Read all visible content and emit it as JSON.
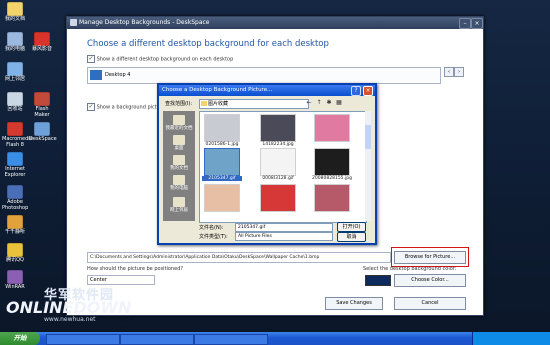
{
  "desktop": {
    "icons": [
      {
        "label": "我的文档",
        "color": "#f2d46b"
      },
      {
        "label": "我的电脑",
        "color": "#9bb8e0"
      },
      {
        "label": "网上邻居",
        "color": "#7fb3e8"
      },
      {
        "label": "回收站",
        "color": "#c9d6e3"
      },
      {
        "label": "Macromedia Flash 8",
        "color": "#d63a2e"
      },
      {
        "label": "Internet Explorer",
        "color": "#3a8ee6"
      },
      {
        "label": "Adobe Photoshop",
        "color": "#4a6fb8"
      },
      {
        "label": "千千静听",
        "color": "#e2a13a"
      },
      {
        "label": "腾讯QQ",
        "color": "#e8c23a"
      },
      {
        "label": "WinRAR",
        "color": "#8a5fb4"
      },
      {
        "label": "暴风影音",
        "color": "#d9342b"
      },
      {
        "label": "Flash Maker",
        "color": "#c24a3a"
      },
      {
        "label": "DeskSpace",
        "color": "#6d9fd8"
      }
    ]
  },
  "app": {
    "title": "Manage Desktop Backgrounds - DeskSpace",
    "heading": "Choose a different desktop background for each desktop",
    "show_different_label": "Show a different desktop background on each desktop",
    "desktop_item": "Desktop 4",
    "show_picture_label": "Show a background picture on the",
    "path_value": "C:\\Documents and Settings\\Administrator\\Application Data\\Otaku\\DeskSpace\\Wallpaper Cache\\1.bmp",
    "browse_label": "Browse for Picture...",
    "position_label": "How should the picture be positioned?",
    "position_value": "Center",
    "color_label": "Select the desktop background color:",
    "choose_color_label": "Choose Color...",
    "save_label": "Save Changes",
    "cancel_label": "Cancel",
    "color_swatch": "#0d2b5c"
  },
  "dialog": {
    "title": "Choose a Desktop Background Picture...",
    "lookin_label": "查找范围(I):",
    "lookin_value": "图片收藏",
    "places": [
      "我最近的文档",
      "桌面",
      "我的文档",
      "我的电脑",
      "网上邻居"
    ],
    "files": [
      {
        "name": "0201586-1.jpg",
        "color": "#c8ccd2",
        "selected": false
      },
      {
        "name": "14182234.jpg",
        "color": "#4a4a58",
        "selected": false
      },
      {
        "name": "",
        "color": "#e07aa0",
        "selected": false
      },
      {
        "name": "2105347.gif",
        "color": "#6fa3c8",
        "selected": true
      },
      {
        "name": "0008I3128.gif",
        "color": "#f4f4f4",
        "selected": false
      },
      {
        "name": "20080828155.jpg",
        "color": "#1d1d1d",
        "selected": false
      },
      {
        "name": "",
        "color": "#e7bfa5",
        "selected": false
      },
      {
        "name": "",
        "color": "#d63838",
        "selected": false
      },
      {
        "name": "",
        "color": "#b65a6a",
        "selected": false
      }
    ],
    "filename_label": "文件名(N):",
    "filename_value": "2105347.gif",
    "filetype_label": "文件类型(T):",
    "filetype_value": "All Picture Files",
    "open_label": "打开(O)",
    "cancel_label": "取消"
  },
  "watermark": {
    "cn": "华军软件园",
    "en": "ONLINEDOWN",
    "url": "www.newhua.net"
  },
  "taskbar": {
    "start_label": "开始",
    "tasks": [
      "",
      "",
      ""
    ],
    "clock": "",
    "accent": "#1d5ad5"
  }
}
